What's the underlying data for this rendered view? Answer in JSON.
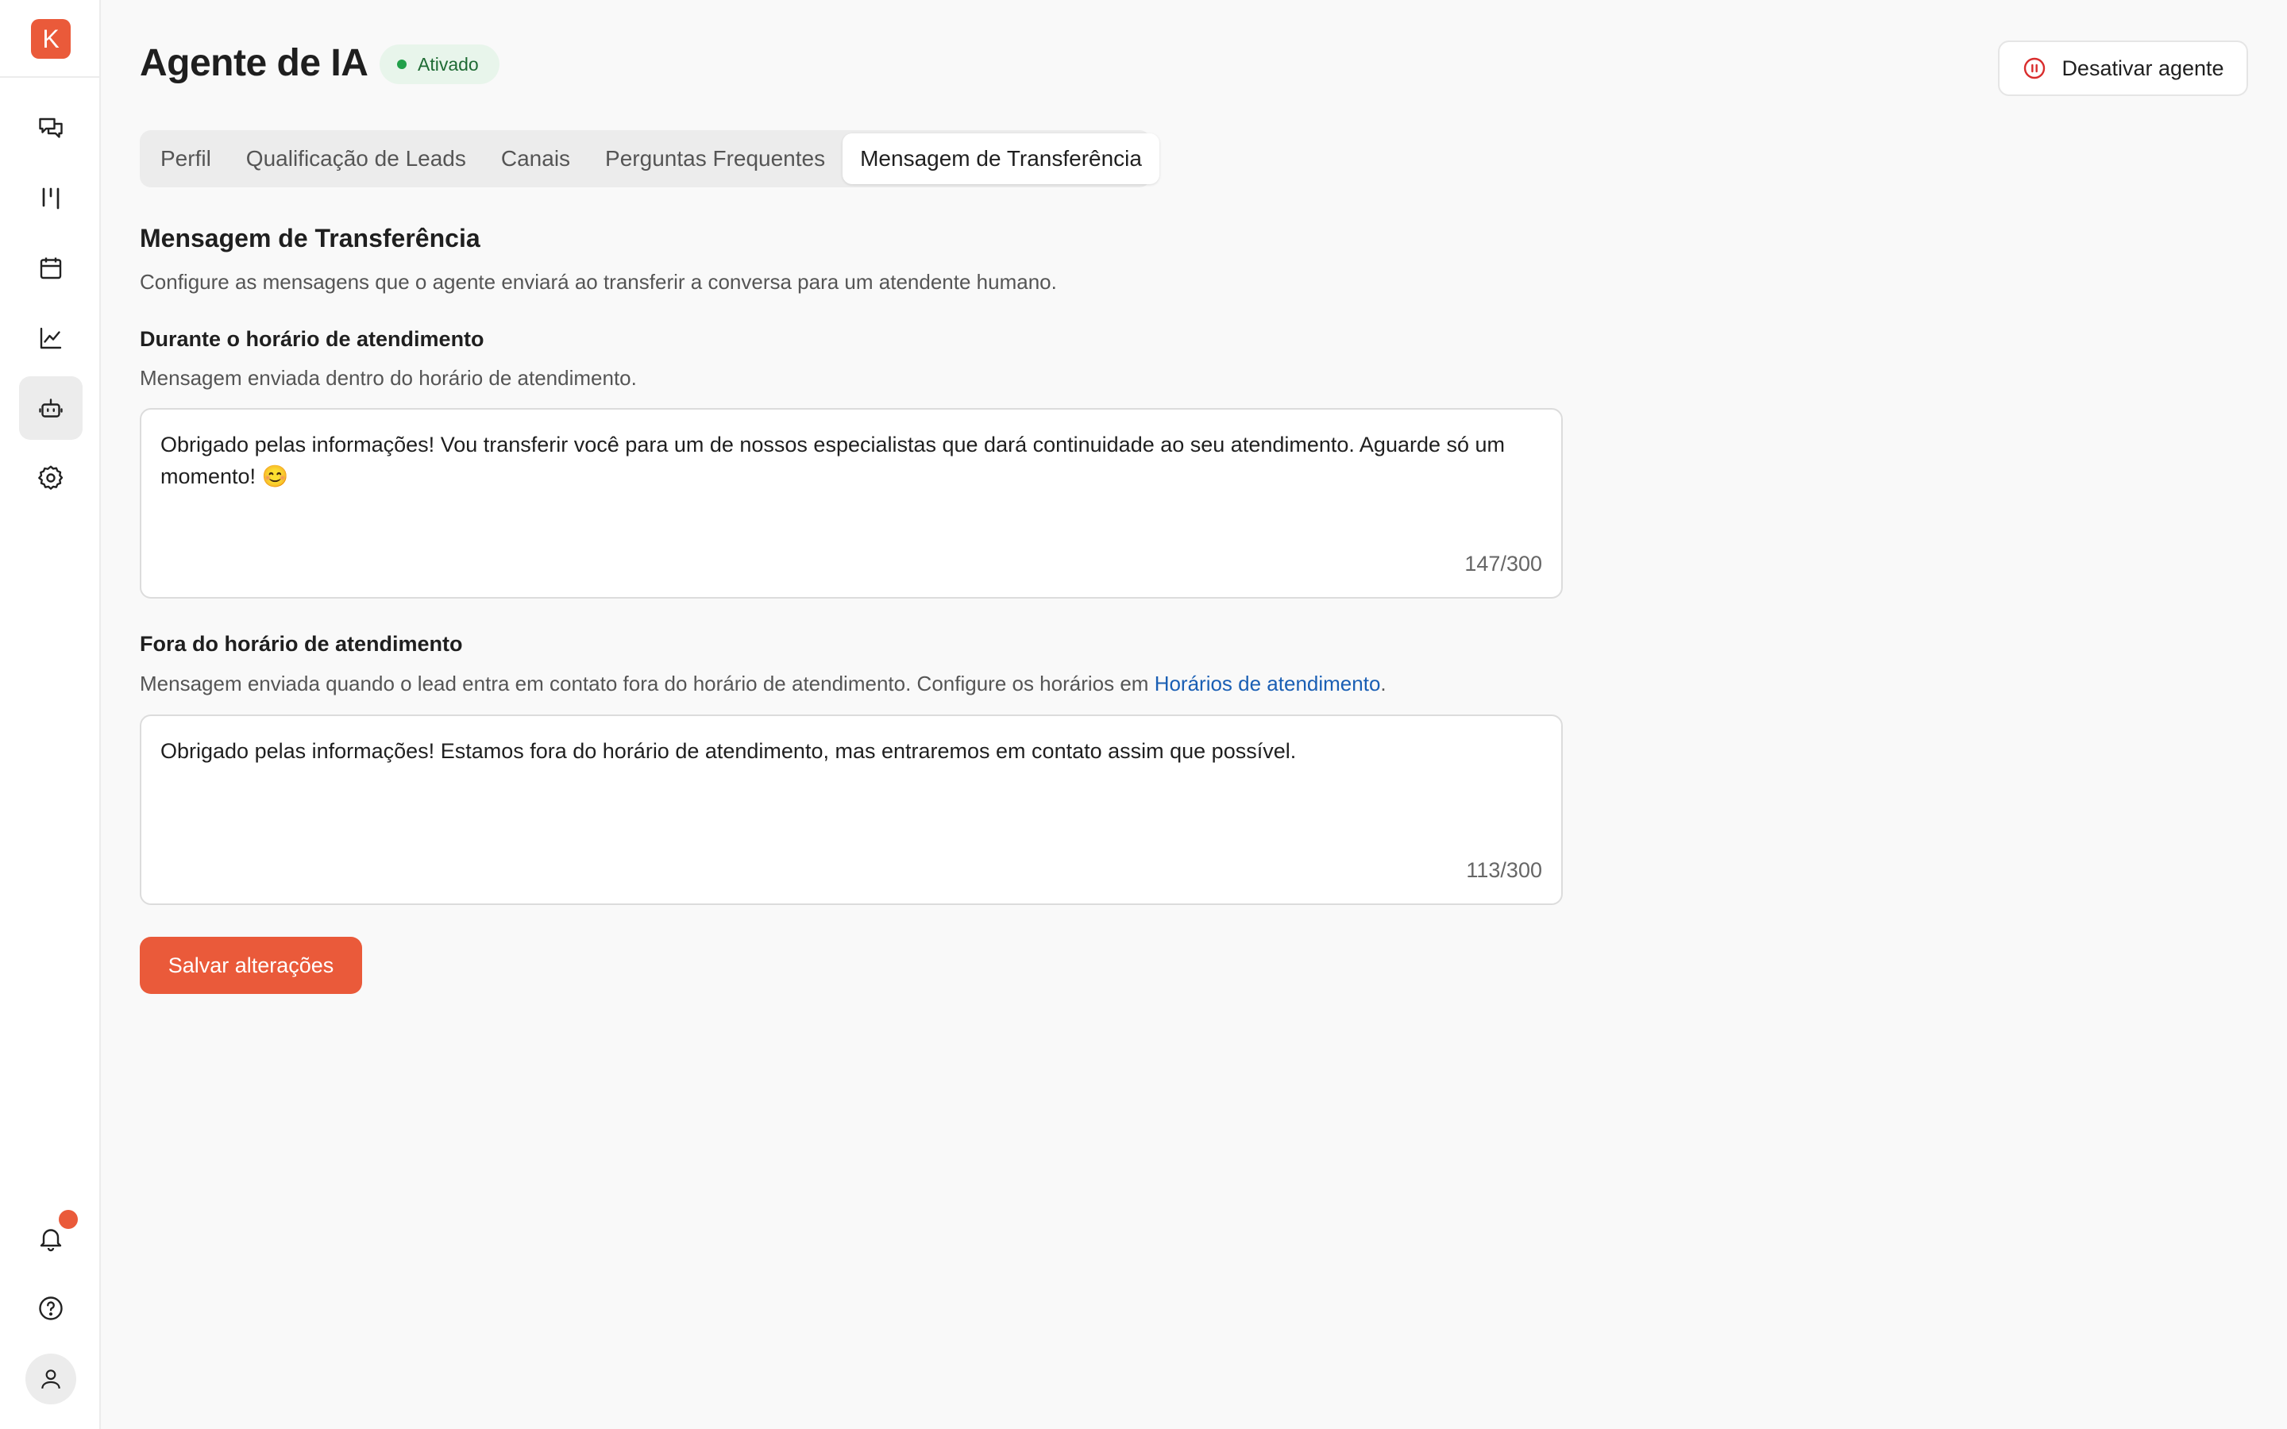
{
  "app": {
    "logo_letter": "K"
  },
  "sidebar": {
    "items": [
      {
        "name": "conversations",
        "icon": "chat-icon"
      },
      {
        "name": "pipeline",
        "icon": "kanban-icon"
      },
      {
        "name": "calendar",
        "icon": "calendar-icon"
      },
      {
        "name": "reports",
        "icon": "chart-icon"
      },
      {
        "name": "ai-agent",
        "icon": "bot-icon",
        "active": true
      },
      {
        "name": "settings",
        "icon": "gear-icon"
      }
    ],
    "bottom": [
      {
        "name": "notifications",
        "icon": "bell-icon",
        "has_badge": true
      },
      {
        "name": "help",
        "icon": "help-icon"
      },
      {
        "name": "profile",
        "icon": "user-icon"
      }
    ]
  },
  "header": {
    "title": "Agente de IA",
    "status_label": "Ativado",
    "deactivate_label": "Desativar agente"
  },
  "tabs": [
    {
      "label": "Perfil",
      "active": false
    },
    {
      "label": "Qualificação de Leads",
      "active": false
    },
    {
      "label": "Canais",
      "active": false
    },
    {
      "label": "Perguntas Frequentes",
      "active": false
    },
    {
      "label": "Mensagem de Transferência",
      "active": true
    }
  ],
  "section": {
    "title": "Mensagem de Transferência",
    "description": "Configure as mensagens que o agente enviará ao transferir a conversa para um atendente humano."
  },
  "during_hours": {
    "label": "Durante o horário de atendimento",
    "help": "Mensagem enviada dentro do horário de atendimento.",
    "value": "Obrigado pelas informações! Vou transferir você para um de nossos especialistas que dará continuidade ao seu atendimento. Aguarde só um momento! 😊",
    "count": "147/300"
  },
  "outside_hours": {
    "label": "Fora do horário de atendimento",
    "help_prefix": "Mensagem enviada quando o lead entra em contato fora do horário de atendimento. Configure os horários em ",
    "help_link": "Horários de atendimento",
    "help_suffix": ".",
    "value": "Obrigado pelas informações! Estamos fora do horário de atendimento, mas entraremos em contato assim que possível.",
    "count": "113/300"
  },
  "save_label": "Salvar alterações",
  "colors": {
    "accent": "#ea5a3a",
    "status_bg": "#e8f5eb",
    "status_dot": "#22a04a",
    "link": "#1a5fb4"
  }
}
